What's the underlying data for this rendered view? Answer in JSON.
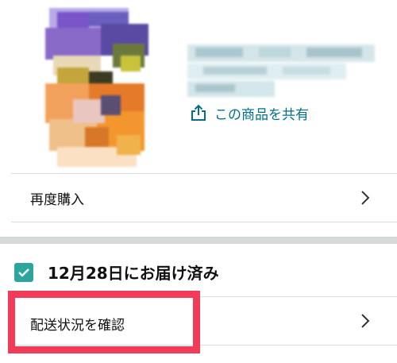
{
  "product": {
    "image_alt": "product-image-pixelated",
    "title_text": "",
    "share_label": "この商品を共有"
  },
  "actions": {
    "rebuy_label": "再度購入"
  },
  "delivery": {
    "status_text": "12月28日にお届け済み",
    "track_label": "配送状況を確認"
  },
  "colors": {
    "link": "#007185",
    "check": "#2aa69e",
    "highlight": "#f23b59",
    "section_separator": "#d5d9d9"
  }
}
